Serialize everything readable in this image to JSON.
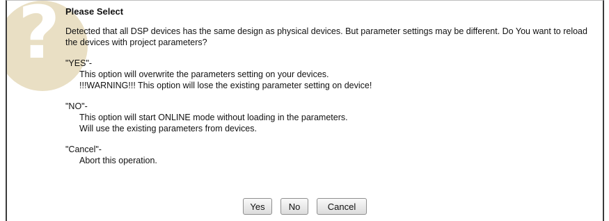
{
  "dialog": {
    "title": "Please Select",
    "message": "Detected that all DSP devices has the same design as physical devices. But parameter settings may be different. Do You want to reload the devices with project parameters?",
    "icon": "question-mark-icon",
    "options": [
      {
        "label": "\"YES\"-",
        "lines": [
          "This option will overwrite the parameters setting on your devices.",
          "!!!WARNING!!! This option will lose the existing parameter setting on device!"
        ]
      },
      {
        "label": "\"NO\"-",
        "lines": [
          "This option will start ONLINE mode without loading in the parameters.",
          "Will use the existing parameters from devices."
        ]
      },
      {
        "label": "\"Cancel\"-",
        "lines": [
          "Abort this operation."
        ]
      }
    ],
    "buttons": {
      "yes": "Yes",
      "no": "No",
      "cancel": "Cancel"
    }
  }
}
